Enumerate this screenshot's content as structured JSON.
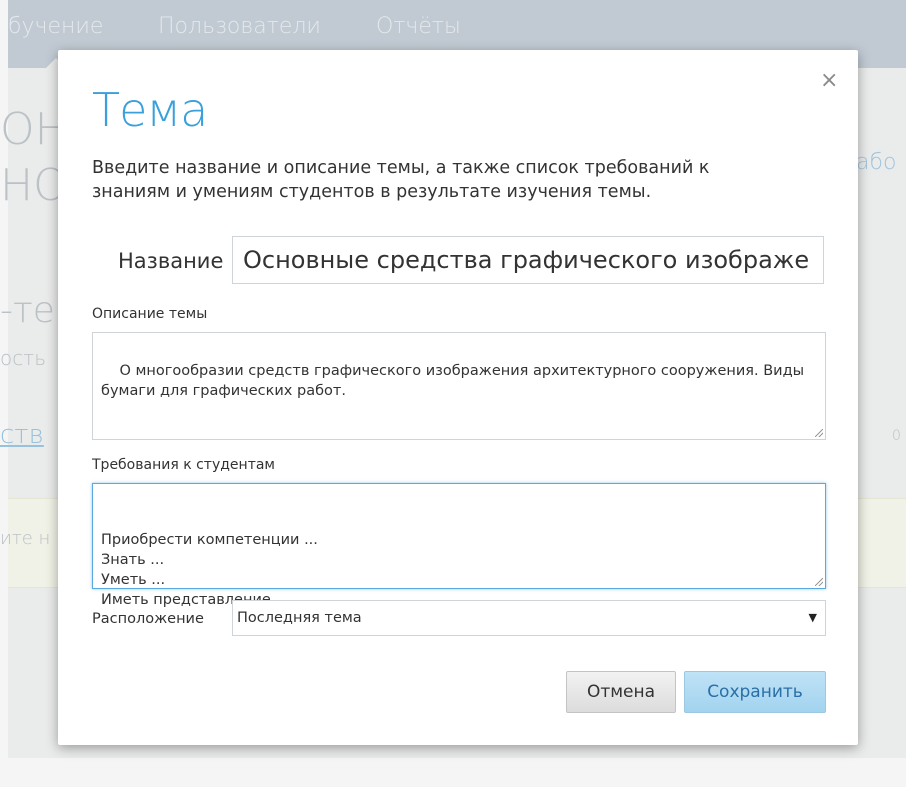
{
  "background": {
    "nav_items": [
      "бучение",
      "Пользователи",
      "Отчёты"
    ],
    "fragments": {
      "f1": "ОН",
      "f2": "НОС",
      "f3": "-те",
      "f4": "ость",
      "f5": "ств",
      "f6": "ите н",
      "f7": "або",
      "f8": "0"
    }
  },
  "modal": {
    "title": "Тема",
    "description": "Введите название и описание темы, а также список требований к знаниям и умениям студентов в результате изучения темы.",
    "name_label": "Название",
    "name_value": "Основные средства графического изображе",
    "description_label": "Описание темы",
    "description_value": "О многообразии средств графического изображения архитектурного сооружения. Виды бумаги для графических работ.",
    "requirements_label": "Требования к студентам",
    "requirements_lines": [
      "Приобрести компетенции ...",
      "Знать ...",
      "Уметь ...",
      "Иметь представление ..."
    ],
    "location_label": "Расположение",
    "location_value": "Последняя тема",
    "cancel_label": "Отмена",
    "save_label": "Сохранить",
    "close_glyph": "×",
    "select_arrow": "▼"
  },
  "colors": {
    "title": "#3aa0dc",
    "save_button": "#a2d3ef",
    "focus_border": "#5aa9de"
  }
}
